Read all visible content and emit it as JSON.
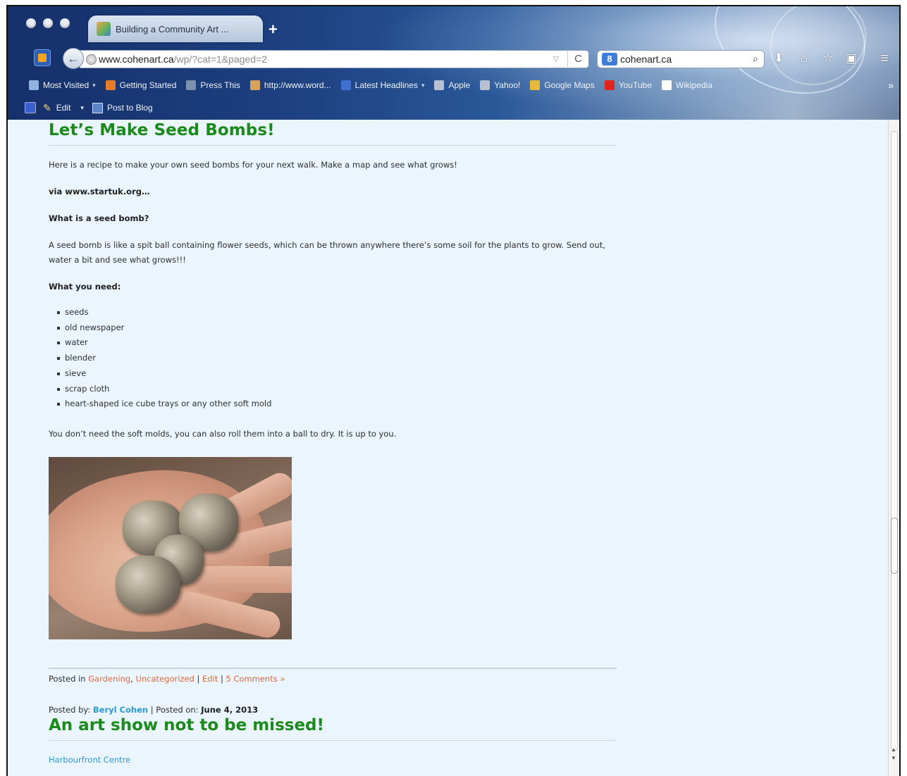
{
  "browser": {
    "tab_title": "Building a Community Art ...",
    "new_tab_symbol": "+",
    "url_host": "www.cohenart.ca",
    "url_path": "/wp/?cat=1&paged=2",
    "search_engine_letter": "8",
    "search_text": "cohenart.ca",
    "reload_symbol": "C",
    "back_symbol": "←"
  },
  "bookmarks": [
    {
      "label": "Most Visited",
      "caret": "▾",
      "icon": "folder-icon",
      "color": "#8fb4e0"
    },
    {
      "label": "Getting Started",
      "icon": "firefox-icon",
      "color": "#e57c28"
    },
    {
      "label": "Press This",
      "icon": "page-icon",
      "color": "#7f92ad"
    },
    {
      "label": "http://www.word...",
      "icon": "wordpress-icon",
      "color": "#d7a35c"
    },
    {
      "label": "Latest Headlines",
      "caret": "▾",
      "icon": "rss-icon",
      "color": "#3f6fd0"
    },
    {
      "label": "Apple",
      "icon": "apple-icon",
      "color": "#b7c1cf"
    },
    {
      "label": "Yahoo!",
      "icon": "page-icon",
      "color": "#b7c1cf"
    },
    {
      "label": "Google Maps",
      "icon": "map-icon",
      "color": "#e7b93a"
    },
    {
      "label": "YouTube",
      "icon": "youtube-icon",
      "color": "#e0261c"
    },
    {
      "label": "Wikipedia",
      "icon": "wikipedia-icon",
      "color": "#ffffff"
    }
  ],
  "bookmarks_overflow": "»",
  "toolbar": {
    "edit_label": "Edit",
    "edit_caret": "▾",
    "post_to_blog_label": "Post to Blog"
  },
  "post1": {
    "title": "Let’s Make Seed Bombs!",
    "intro": "Here is a recipe to make your own seed bombs for your next walk. Make a map and see what grows!",
    "via": "via www.startuk.org…",
    "question": "What is a seed bomb?",
    "answer": "A seed bomb is like a spit ball containing flower seeds, which can be thrown anywhere there’s some soil for the plants to grow. Send out, water a bit and see what grows!!!",
    "needs_heading": "What you need:",
    "needs": [
      "seeds",
      "old newspaper",
      "water",
      "blender",
      "sieve",
      "scrap cloth",
      "heart-shaped ice cube trays or any other soft mold"
    ],
    "closing": "You don’t need the soft molds, you can also roll them into a ball to dry. It is up to you.",
    "meta": {
      "posted_in": "Posted in",
      "cat1": "Gardening",
      "comma": ",",
      "cat2": "Uncategorized",
      "sep": "|",
      "edit": "Edit",
      "comments": "5 Comments »"
    }
  },
  "post2": {
    "posted_by_label": "Posted by:",
    "author": "Beryl Cohen",
    "posted_on_label": "| Posted on:",
    "date": "June 4, 2013",
    "title": "An art show not to be missed!",
    "link": "Harbourfront Centre"
  },
  "colors": {
    "title_green": "#1b8a1b",
    "link_orange": "#e0693a",
    "link_blue": "#2c9ad6",
    "page_bg": "#eaf5fd"
  }
}
